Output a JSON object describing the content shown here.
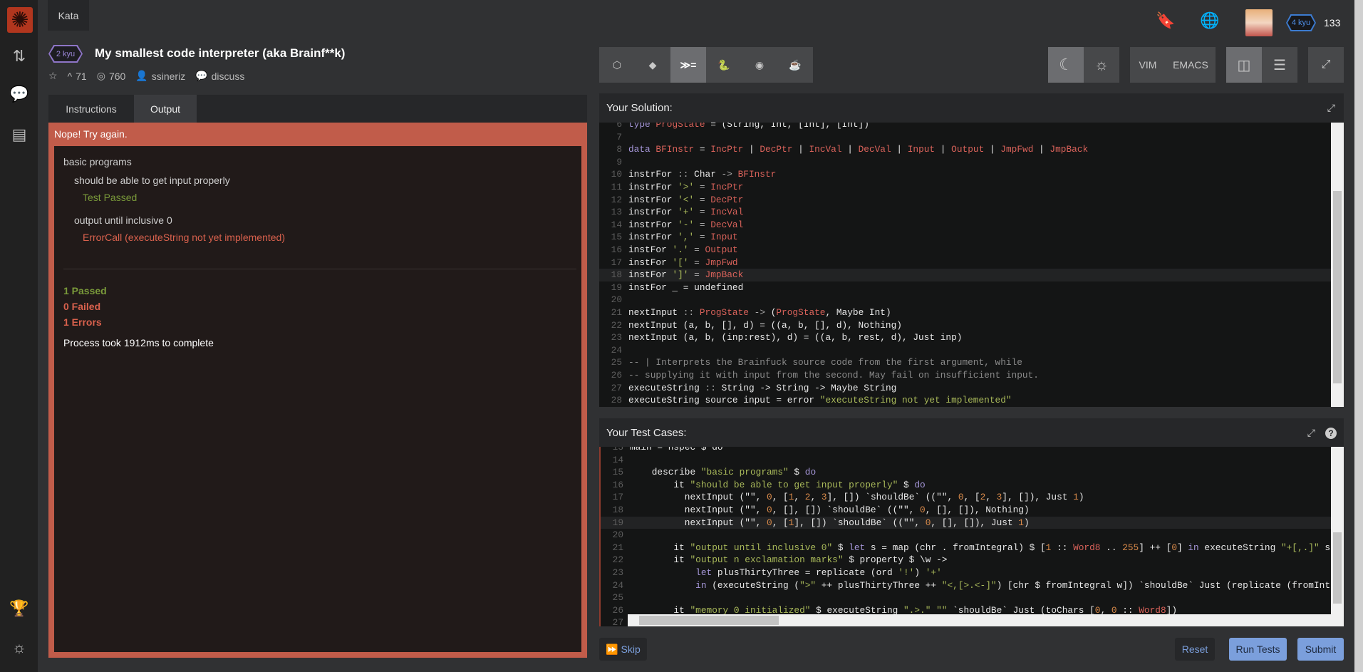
{
  "sidebar": {
    "logo": "codewars-logo",
    "icons": [
      "pull-request-icon",
      "chat-icon",
      "document-icon",
      "trophy-icon",
      "lightbulb-icon"
    ]
  },
  "top": {
    "tab": "Kata",
    "rank": "4 kyu",
    "honor": "133"
  },
  "kata": {
    "kyu": "2 kyu",
    "title": "My smallest code interpreter (aka Brainf**k)",
    "votes": "71",
    "completed": "760",
    "author": "ssineriz",
    "discuss": "discuss"
  },
  "left_tabs": [
    "Instructions",
    "Output"
  ],
  "output": {
    "banner": "Nope! Try again.",
    "group": "basic programs",
    "test1": "should be able to get input properly",
    "test1_result": "Test Passed",
    "test2": "output until inclusive 0",
    "test2_result": "ErrorCall (executeString not yet implemented)",
    "passed": "1 Passed",
    "failed": "0 Failed",
    "errors": "1 Errors",
    "time": "Process took 1912ms to complete"
  },
  "toolbar": {
    "languages": [
      "javascript",
      "ruby",
      "haskell",
      "python",
      "clojure",
      "java"
    ],
    "active_language": "haskell",
    "modes": [
      "VIM",
      "EMACS"
    ],
    "theme_active": "dark"
  },
  "colors": {
    "error": "#c15c4a",
    "pass": "#7a9a3a",
    "accent": "#7b9fdc"
  },
  "solution": {
    "title": "Your Solution:",
    "lines": [
      {
        "n": "6",
        "t": [
          [
            "kw",
            "type"
          ],
          [
            "plain",
            " "
          ],
          [
            "ty",
            "ProgState"
          ],
          [
            "plain",
            " = (String, Int, [Int], [Int])"
          ]
        ]
      },
      {
        "n": "7",
        "t": []
      },
      {
        "n": "8",
        "t": [
          [
            "kw",
            "data"
          ],
          [
            "plain",
            " "
          ],
          [
            "ty",
            "BFInstr"
          ],
          [
            "plain",
            " = "
          ],
          [
            "ty",
            "IncPtr"
          ],
          [
            "plain",
            " | "
          ],
          [
            "ty",
            "DecPtr"
          ],
          [
            "plain",
            " | "
          ],
          [
            "ty",
            "IncVal"
          ],
          [
            "plain",
            " | "
          ],
          [
            "ty",
            "DecVal"
          ],
          [
            "plain",
            " | "
          ],
          [
            "ty",
            "Input"
          ],
          [
            "plain",
            " | "
          ],
          [
            "ty",
            "Output"
          ],
          [
            "plain",
            " | "
          ],
          [
            "ty",
            "JmpFwd"
          ],
          [
            "plain",
            " | "
          ],
          [
            "ty",
            "JmpBack"
          ]
        ]
      },
      {
        "n": "9",
        "t": []
      },
      {
        "n": "10",
        "t": [
          [
            "plain",
            "instrFor"
          ],
          [
            "op",
            " :: "
          ],
          [
            "plain",
            "Char"
          ],
          [
            "op",
            " -> "
          ],
          [
            "ty",
            "BFInstr"
          ]
        ]
      },
      {
        "n": "11",
        "t": [
          [
            "plain",
            "instrFor "
          ],
          [
            "str",
            "'>'"
          ],
          [
            "op",
            " = "
          ],
          [
            "ty",
            "IncPtr"
          ]
        ]
      },
      {
        "n": "12",
        "t": [
          [
            "plain",
            "instrFor "
          ],
          [
            "str",
            "'<'"
          ],
          [
            "op",
            " = "
          ],
          [
            "ty",
            "DecPtr"
          ]
        ]
      },
      {
        "n": "13",
        "t": [
          [
            "plain",
            "instrFor "
          ],
          [
            "str",
            "'+'"
          ],
          [
            "op",
            " = "
          ],
          [
            "ty",
            "IncVal"
          ]
        ]
      },
      {
        "n": "14",
        "t": [
          [
            "plain",
            "instrFor "
          ],
          [
            "str",
            "'-'"
          ],
          [
            "op",
            " = "
          ],
          [
            "ty",
            "DecVal"
          ]
        ]
      },
      {
        "n": "15",
        "t": [
          [
            "plain",
            "instrFor "
          ],
          [
            "str",
            "','"
          ],
          [
            "op",
            " = "
          ],
          [
            "ty",
            "Input"
          ]
        ]
      },
      {
        "n": "16",
        "t": [
          [
            "plain",
            "instFor "
          ],
          [
            "str",
            "'.'"
          ],
          [
            "op",
            " = "
          ],
          [
            "ty",
            "Output"
          ]
        ]
      },
      {
        "n": "17",
        "t": [
          [
            "plain",
            "instFor "
          ],
          [
            "str",
            "'['"
          ],
          [
            "op",
            " = "
          ],
          [
            "ty",
            "JmpFwd"
          ]
        ]
      },
      {
        "n": "18",
        "t": [
          [
            "plain",
            "instFor "
          ],
          [
            "str",
            "']'"
          ],
          [
            "op",
            " = "
          ],
          [
            "ty",
            "JmpBack"
          ]
        ]
      },
      {
        "n": "19",
        "t": [
          [
            "plain",
            "instFor _ = undefined"
          ]
        ]
      },
      {
        "n": "20",
        "t": []
      },
      {
        "n": "21",
        "t": [
          [
            "plain",
            "nextInput"
          ],
          [
            "op",
            " :: "
          ],
          [
            "ty",
            "ProgState"
          ],
          [
            "op",
            " -> "
          ],
          [
            "plain",
            "("
          ],
          [
            "ty",
            "ProgState"
          ],
          [
            "plain",
            ", Maybe Int)"
          ]
        ]
      },
      {
        "n": "22",
        "t": [
          [
            "plain",
            "nextInput (a, b, [], d) = ((a, b, [], d), Nothing)"
          ]
        ]
      },
      {
        "n": "23",
        "t": [
          [
            "plain",
            "nextInput (a, b, (inp:rest), d) = ((a, b, rest, d), Just inp)"
          ]
        ]
      },
      {
        "n": "24",
        "t": []
      },
      {
        "n": "25",
        "t": [
          [
            "cm",
            "-- | Interprets the Brainfuck source code from the first argument, while"
          ]
        ]
      },
      {
        "n": "26",
        "t": [
          [
            "cm",
            "-- supplying it with input from the second. May fail on insufficient input."
          ]
        ]
      },
      {
        "n": "27",
        "t": [
          [
            "plain",
            "executeString"
          ],
          [
            "op",
            " :: "
          ],
          [
            "plain",
            "String -> String -> Maybe String"
          ]
        ]
      },
      {
        "n": "28",
        "t": [
          [
            "plain",
            "executeString source input = error "
          ],
          [
            "str",
            "\"executeString not yet implemented\""
          ]
        ]
      }
    ]
  },
  "tests": {
    "title": "Your Test Cases:",
    "lines": [
      {
        "n": "13",
        "t": [
          [
            "plain",
            "main = hspec $ do"
          ]
        ]
      },
      {
        "n": "14",
        "t": []
      },
      {
        "n": "15",
        "t": [
          [
            "plain",
            "    describe "
          ],
          [
            "str",
            "\"basic programs\""
          ],
          [
            "plain",
            " $ "
          ],
          [
            "kw",
            "do"
          ]
        ]
      },
      {
        "n": "16",
        "t": [
          [
            "plain",
            "        it "
          ],
          [
            "str",
            "\"should be able to get input properly\""
          ],
          [
            "plain",
            " $ "
          ],
          [
            "kw",
            "do"
          ]
        ]
      },
      {
        "n": "17",
        "t": [
          [
            "plain",
            "          nextInput (\"\", "
          ],
          [
            "num",
            "0"
          ],
          [
            "plain",
            ", ["
          ],
          [
            "num",
            "1"
          ],
          [
            "plain",
            ", "
          ],
          [
            "num",
            "2"
          ],
          [
            "plain",
            ", "
          ],
          [
            "num",
            "3"
          ],
          [
            "plain",
            "], []) `shouldBe` ((\"\", "
          ],
          [
            "num",
            "0"
          ],
          [
            "plain",
            ", ["
          ],
          [
            "num",
            "2"
          ],
          [
            "plain",
            ", "
          ],
          [
            "num",
            "3"
          ],
          [
            "plain",
            "], []), Just "
          ],
          [
            "num",
            "1"
          ],
          [
            "plain",
            ")"
          ]
        ]
      },
      {
        "n": "18",
        "t": [
          [
            "plain",
            "          nextInput (\"\", "
          ],
          [
            "num",
            "0"
          ],
          [
            "plain",
            ", [], []) `shouldBe` ((\"\", "
          ],
          [
            "num",
            "0"
          ],
          [
            "plain",
            ", [], []), Nothing)"
          ]
        ]
      },
      {
        "n": "19",
        "t": [
          [
            "plain",
            "          nextInput (\"\", "
          ],
          [
            "num",
            "0"
          ],
          [
            "plain",
            ", ["
          ],
          [
            "num",
            "1"
          ],
          [
            "plain",
            "], []) `shouldBe` ((\"\", "
          ],
          [
            "num",
            "0"
          ],
          [
            "plain",
            ", [], []), Just "
          ],
          [
            "num",
            "1"
          ],
          [
            "plain",
            ")"
          ]
        ]
      },
      {
        "n": "20",
        "t": []
      },
      {
        "n": "21",
        "t": [
          [
            "plain",
            "        it "
          ],
          [
            "str",
            "\"output until inclusive 0\""
          ],
          [
            "plain",
            " $ "
          ],
          [
            "kw",
            "let"
          ],
          [
            "plain",
            " s = map (chr . fromIntegral) $ ["
          ],
          [
            "num",
            "1"
          ],
          [
            "plain",
            " :: "
          ],
          [
            "ty",
            "Word8"
          ],
          [
            "plain",
            " .. "
          ],
          [
            "num",
            "255"
          ],
          [
            "plain",
            "] ++ ["
          ],
          [
            "num",
            "0"
          ],
          [
            "plain",
            "] "
          ],
          [
            "kw",
            "in"
          ],
          [
            "plain",
            " executeString "
          ],
          [
            "str",
            "\"+[,.]\""
          ],
          [
            "plain",
            " s"
          ]
        ]
      },
      {
        "n": "22",
        "t": [
          [
            "plain",
            "        it "
          ],
          [
            "str",
            "\"output n exclamation marks\""
          ],
          [
            "plain",
            " $ property $ \\w ->"
          ]
        ]
      },
      {
        "n": "23",
        "t": [
          [
            "plain",
            "            "
          ],
          [
            "kw",
            "let"
          ],
          [
            "plain",
            " plusThirtyThree = replicate (ord "
          ],
          [
            "str",
            "'!'"
          ],
          [
            "plain",
            ") "
          ],
          [
            "str",
            "'+'"
          ]
        ]
      },
      {
        "n": "24",
        "t": [
          [
            "plain",
            "            "
          ],
          [
            "kw",
            "in"
          ],
          [
            "plain",
            " (executeString ("
          ],
          [
            "str",
            "\">\""
          ],
          [
            "plain",
            " ++ plusThirtyThree ++ "
          ],
          [
            "str",
            "\"<,[>.<-]\""
          ],
          [
            "plain",
            ") [chr $ fromIntegral w]) `shouldBe` Just (replicate (fromInt"
          ]
        ]
      },
      {
        "n": "25",
        "t": []
      },
      {
        "n": "26",
        "t": [
          [
            "plain",
            "        it "
          ],
          [
            "str",
            "\"memory 0 initialized\""
          ],
          [
            "plain",
            " $ executeString "
          ],
          [
            "str",
            "\".>.\""
          ],
          [
            "plain",
            " "
          ],
          [
            "str",
            "\"\""
          ],
          [
            "plain",
            " `shouldBe` Just (toChars ["
          ],
          [
            "num",
            "0"
          ],
          [
            "plain",
            ", "
          ],
          [
            "num",
            "0"
          ],
          [
            "plain",
            " :: "
          ],
          [
            "ty",
            "Word8"
          ],
          [
            "plain",
            "])"
          ]
        ]
      },
      {
        "n": "27",
        "t": []
      }
    ]
  },
  "actions": {
    "skip": "Skip",
    "reset": "Reset",
    "run": "Run Tests",
    "submit": "Submit"
  }
}
